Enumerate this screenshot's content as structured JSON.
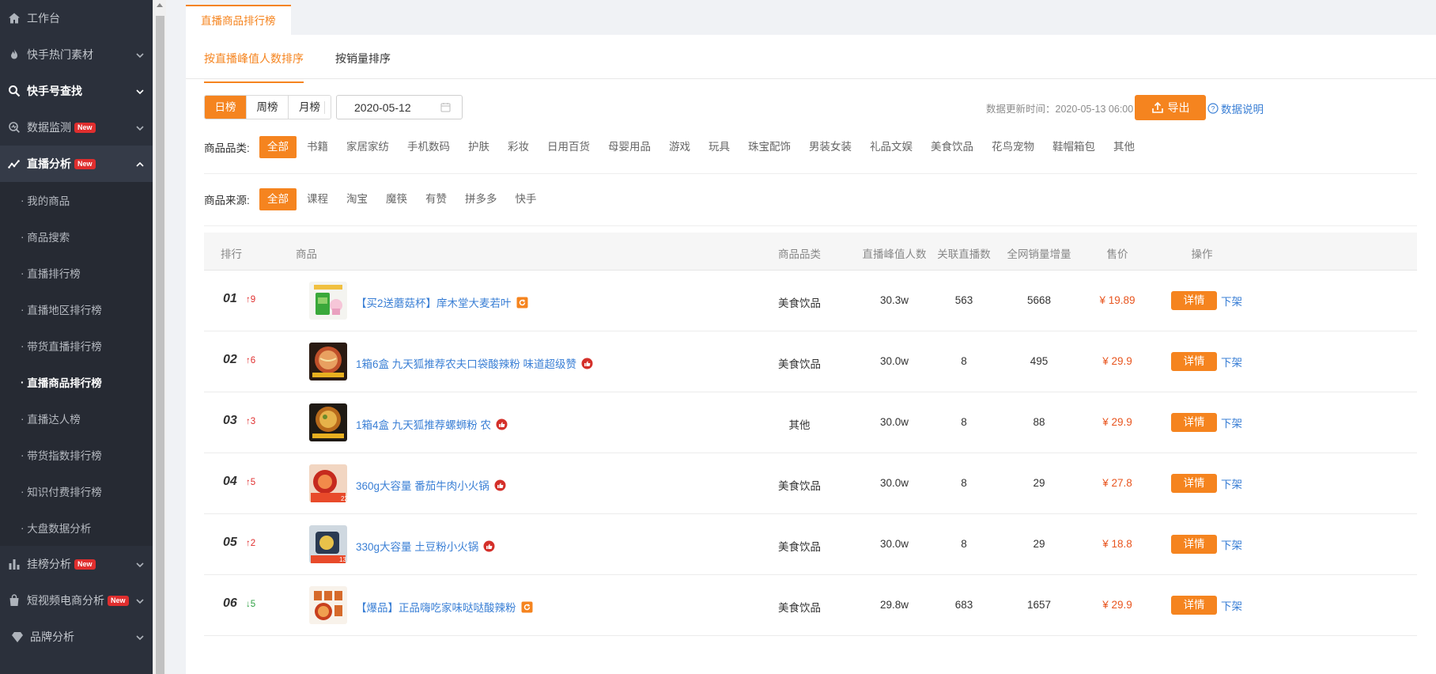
{
  "sidebar": {
    "items": [
      {
        "label": "工作台",
        "icon": "home-icon"
      },
      {
        "label": "快手热门素材",
        "icon": "flame-icon"
      },
      {
        "label": "快手号查找",
        "icon": "search-icon"
      },
      {
        "label": "数据监测",
        "icon": "monitor-icon",
        "badge": "New"
      },
      {
        "label": "直播分析",
        "icon": "trend-icon",
        "badge": "New"
      }
    ],
    "sub_items": [
      "我的商品",
      "商品搜索",
      "直播排行榜",
      "直播地区排行榜",
      "带货直播排行榜",
      "直播商品排行榜",
      "直播达人榜",
      "带货指数排行榜",
      "知识付费排行榜",
      "大盘数据分析"
    ],
    "bottom_items": [
      {
        "label": "挂榜分析",
        "icon": "bar-chart-icon",
        "badge": "New"
      },
      {
        "label": "短视频电商分析",
        "icon": "bag-icon",
        "badge": "New"
      },
      {
        "label": "品牌分析",
        "icon": "diamond-icon"
      }
    ]
  },
  "page_tab": "直播商品排行榜",
  "sort_tabs": [
    "按直播峰值人数排序",
    "按销量排序"
  ],
  "ranges": [
    "日榜",
    "周榜",
    "月榜"
  ],
  "date": "2020-05-12",
  "update_time": "数据更新时间：2020-05-13 06:00",
  "export_label": "导出",
  "help_label": "数据说明",
  "category_filter": {
    "label": "商品品类:",
    "options": [
      "全部",
      "书籍",
      "家居家纺",
      "手机数码",
      "护肤",
      "彩妆",
      "日用百货",
      "母婴用品",
      "游戏",
      "玩具",
      "珠宝配饰",
      "男装女装",
      "礼品文娱",
      "美食饮品",
      "花鸟宠物",
      "鞋帽箱包",
      "其他"
    ]
  },
  "source_filter": {
    "label": "商品来源:",
    "options": [
      "全部",
      "课程",
      "淘宝",
      "魔筷",
      "有赞",
      "拼多多",
      "快手"
    ]
  },
  "table": {
    "headers": {
      "rank": "排行",
      "product": "商品",
      "category": "商品品类",
      "peak": "直播峰值人数",
      "streams": "关联直播数",
      "sales": "全网销量增量",
      "price": "售价",
      "action": "操作"
    },
    "detail_label": "详情",
    "offshelf_label": "下架",
    "rows": [
      {
        "rank": "01",
        "change": "↑9",
        "dir": "up",
        "name": "【买2送蘑菇杯】庠木堂大麦若叶",
        "tag": "refresh-tag-icon",
        "category": "美食饮品",
        "peak": "30.3w",
        "streams": "563",
        "sales": "5668",
        "price": "¥ 19.89"
      },
      {
        "rank": "02",
        "change": "↑6",
        "dir": "up",
        "name": "1箱6盒 九天狐推荐农夫口袋酸辣粉 味道超级赞",
        "tag": "thumb-tag-icon",
        "category": "美食饮品",
        "peak": "30.0w",
        "streams": "8",
        "sales": "495",
        "price": "¥ 29.9"
      },
      {
        "rank": "03",
        "change": "↑3",
        "dir": "up",
        "name": "1箱4盒 九天狐推荐螺蛳粉 农",
        "tag": "thumb-tag-icon",
        "category": "其他",
        "peak": "30.0w",
        "streams": "8",
        "sales": "88",
        "price": "¥ 29.9"
      },
      {
        "rank": "04",
        "change": "↑5",
        "dir": "up",
        "name": "360g大容量 番茄牛肉小火锅",
        "tag": "thumb-tag-icon",
        "category": "美食饮品",
        "peak": "30.0w",
        "streams": "8",
        "sales": "29",
        "price": "¥ 27.8"
      },
      {
        "rank": "05",
        "change": "↑2",
        "dir": "up",
        "name": "330g大容量 土豆粉小火锅",
        "tag": "thumb-tag-icon",
        "category": "美食饮品",
        "peak": "30.0w",
        "streams": "8",
        "sales": "29",
        "price": "¥ 18.8"
      },
      {
        "rank": "06",
        "change": "↓5",
        "dir": "down",
        "name": "【爆品】正品嗨吃家味哒哒酸辣粉",
        "tag": "refresh-tag-icon",
        "category": "美食饮品",
        "peak": "29.8w",
        "streams": "683",
        "sales": "1657",
        "price": "¥ 29.9"
      }
    ]
  }
}
